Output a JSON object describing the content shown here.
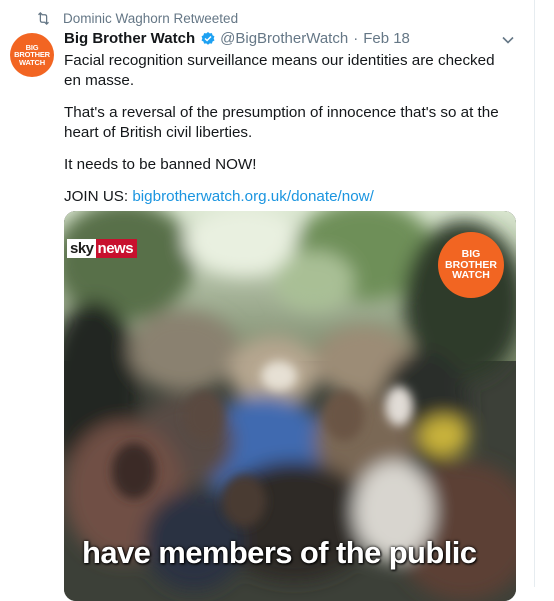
{
  "retweet": {
    "icon": "retweet-icon",
    "text": "Dominic Waghorn Retweeted"
  },
  "author": {
    "avatar_lines": [
      "BIG",
      "BROTHER",
      "WATCH"
    ],
    "display_name": "Big Brother Watch",
    "verified_icon": "verified-badge-icon",
    "handle": "@BigBrotherWatch",
    "separator": "·",
    "date": "Feb 18"
  },
  "menu": {
    "icon": "chevron-down-icon"
  },
  "tweet": {
    "paragraph_1": "Facial recognition surveillance means our identities are checked en masse.",
    "paragraph_2": "That's a reversal of the presumption of innocence that's so at the heart of British civil liberties.",
    "paragraph_3": "It needs to be banned NOW!",
    "join_label": "JOIN US: ",
    "link": "bigbrotherwatch.org.uk/donate/now/"
  },
  "media": {
    "sky_logo_sky": "sky",
    "sky_logo_news": "news",
    "watermark_lines": [
      "BIG",
      "BROTHER",
      "WATCH"
    ],
    "caption": "have members of the public"
  },
  "colors": {
    "brand_orange": "#f26522",
    "link_blue": "#1b95e0",
    "muted_gray": "#657786",
    "sky_red": "#c8102e"
  }
}
